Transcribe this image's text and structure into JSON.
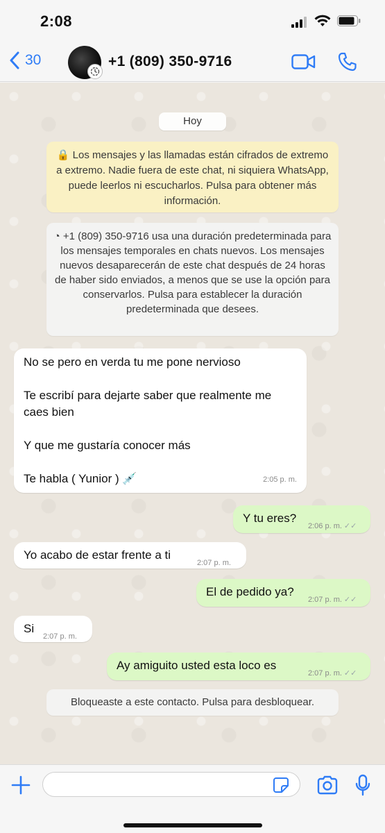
{
  "status": {
    "time": "2:08"
  },
  "header": {
    "back_count": "30",
    "contact": "+1 (809) 350-9716"
  },
  "chat": {
    "date_pill": "Hoy",
    "encryption_notice": "🔒 Los mensajes y las llamadas están cifrados de extremo a extremo. Nadie fuera de este chat, ni siquiera WhatsApp, puede leerlos ni escucharlos. Pulsa para obtener más información.",
    "disappearing_notice": "+1 (809) 350-9716 usa una duración predeterminada para los mensajes temporales en chats nuevos. Los mensajes nuevos desaparecerán de este chat después de 24 horas de haber sido enviados, a menos que se use la opción para conservarlos. Pulsa para establecer la duración predeterminada que desees.",
    "messages": [
      {
        "lines": [
          "No se pero en verda tu me pone nervioso",
          "Te escribí para dejarte saber que realmente me caes bien",
          "Y que me gustaría conocer más",
          "Te habla ( Yunior ) 💉"
        ],
        "time": "2:05 p. m."
      },
      {
        "text": "Y tu eres?",
        "time": "2:06 p. m."
      },
      {
        "text": "Yo acabo de estar frente a ti",
        "time": "2:07 p. m."
      },
      {
        "text": "El de pedido ya?",
        "time": "2:07 p. m."
      },
      {
        "text": "Si",
        "time": "2:07 p. m."
      },
      {
        "text": "Ay amiguito usted esta loco es",
        "time": "2:07 p. m."
      }
    ],
    "blocked_notice": "Bloqueaste a este contacto. Pulsa para desbloquear."
  },
  "input": {
    "placeholder": ""
  },
  "colors": {
    "accent": "#2f7cf6",
    "outgoing": "#dcf8c6",
    "incoming": "#ffffff",
    "notice": "#faf1c4"
  }
}
